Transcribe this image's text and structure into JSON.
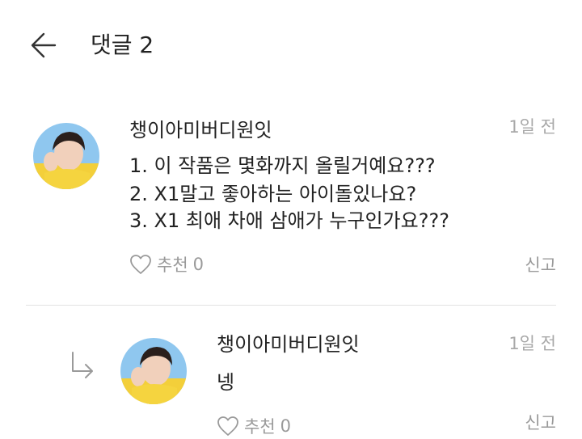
{
  "header": {
    "title": "댓글 2"
  },
  "comments": [
    {
      "author": "챙이아미버디원잇",
      "time": "1일 전",
      "lines": [
        "1. 이 작품은 몇화까지 올릴거예요???",
        "2. X1말고 좋아하는 아이돌있나요?",
        "3. X1 최애 차애 삼애가 누구인가요???"
      ],
      "like_label": "추천",
      "like_count": "0",
      "report_label": "신고"
    }
  ],
  "reply": {
    "author": "챙이아미버디원잇",
    "time": "1일 전",
    "text": "넹",
    "like_label": "추천",
    "like_count": "0",
    "report_label": "신고"
  },
  "colors": {
    "text": "#222222",
    "muted": "#9a9a9a",
    "divider": "#e2e2e2"
  },
  "icons": [
    "back-arrow-icon",
    "heart-icon",
    "reply-arrow-icon"
  ]
}
